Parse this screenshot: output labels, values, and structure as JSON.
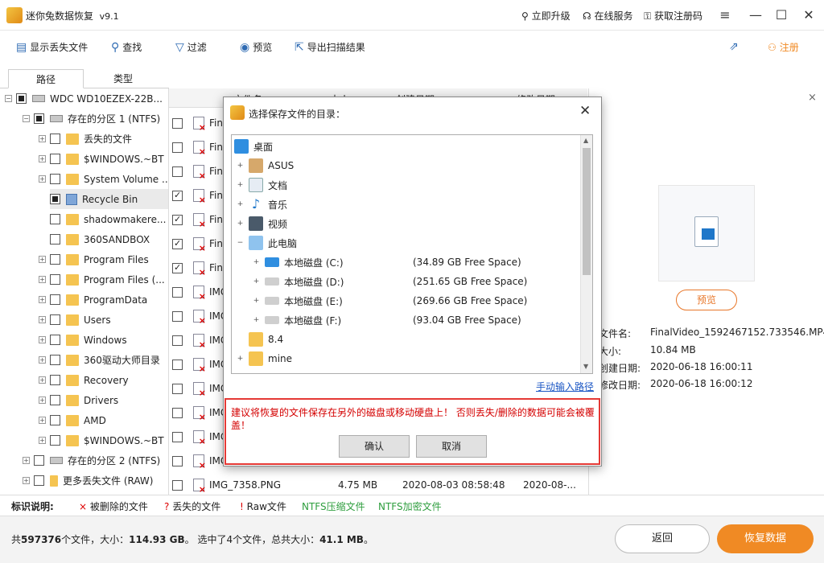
{
  "app": {
    "title": "迷你兔数据恢复",
    "version": "v9.1"
  },
  "titlebar": {
    "upgrade": "立即升级",
    "service": "在线服务",
    "register_code": "获取注册码"
  },
  "toolbar": {
    "show_lost": "显示丢失文件",
    "find": "查找",
    "filter": "过滤",
    "preview": "预览",
    "export": "导出扫描结果",
    "register": "注册"
  },
  "tabs": [
    "路径",
    "类型"
  ],
  "tree": [
    {
      "label": "WDC WD10EZEX-22B..."
    },
    {
      "label": "存在的分区 1 (NTFS)"
    },
    {
      "label": "丢失的文件"
    },
    {
      "label": "$WINDOWS.~BT"
    },
    {
      "label": "System Volume ..."
    },
    {
      "label": "Recycle Bin"
    },
    {
      "label": "shadowmakere..."
    },
    {
      "label": "360SANDBOX"
    },
    {
      "label": "Program Files"
    },
    {
      "label": "Program Files (..."
    },
    {
      "label": "ProgramData"
    },
    {
      "label": "Users"
    },
    {
      "label": "Windows"
    },
    {
      "label": "360驱动大师目录"
    },
    {
      "label": "Recovery"
    },
    {
      "label": "Drivers"
    },
    {
      "label": "AMD"
    },
    {
      "label": "$WINDOWS.~BT"
    },
    {
      "label": "存在的分区 2 (NTFS)"
    },
    {
      "label": "更多丢失文件 (RAW)"
    }
  ],
  "filelist": {
    "headers": [
      "文件名",
      "大小",
      "创建日期",
      "修改日期"
    ],
    "rows": [
      "Fina",
      "Fina",
      "Fina",
      "Fina",
      "Fina",
      "Fina",
      "Fina",
      "IMG_",
      "IMG_",
      "IMG_",
      "IMG_",
      "IMG_",
      "IMG_",
      "IMG_",
      "IMG_"
    ],
    "last": {
      "name": "IMG_7358.PNG",
      "size": "4.75 MB",
      "created": "2020-08-03 08:58:48",
      "modified": "2020-08-..."
    }
  },
  "preview": {
    "button": "预览",
    "labels": [
      "文件名:",
      "大小:",
      "创建日期:",
      "修改日期:"
    ],
    "values": [
      "FinalVideo_1592467152.733546.MP4",
      "10.84 MB",
      "2020-06-18 16:00:11",
      "2020-06-18 16:00:12"
    ]
  },
  "legend": {
    "title": "标识说明:",
    "deleted": "被删除的文件",
    "lost": "丢失的文件",
    "raw": "Raw文件",
    "ntfs_compressed": "NTFS压缩文件",
    "ntfs_encrypted": "NTFS加密文件"
  },
  "status": {
    "summary_prefix": "共",
    "total_files": "597376",
    "summary_mid": "个文件，大小：",
    "total_size": "114.93 GB",
    "summary_sel": "。 选中了4个文件，总共大小：",
    "sel_size": "41.1 MB",
    "summary_end": "。",
    "back": "返回",
    "recover": "恢复数据"
  },
  "dialog": {
    "title": "选择保存文件的目录：",
    "nodes": [
      {
        "label": "桌面",
        "space": ""
      },
      {
        "label": "ASUS",
        "space": ""
      },
      {
        "label": "文档",
        "space": ""
      },
      {
        "label": "音乐",
        "space": ""
      },
      {
        "label": "视频",
        "space": ""
      },
      {
        "label": "此电脑",
        "space": ""
      },
      {
        "label": "本地磁盘 (C:)",
        "space": "(34.89 GB Free Space)"
      },
      {
        "label": "本地磁盘 (D:)",
        "space": "(251.65 GB Free Space)"
      },
      {
        "label": "本地磁盘 (E:)",
        "space": "(269.66 GB Free Space)"
      },
      {
        "label": "本地磁盘 (F:)",
        "space": "(93.04 GB Free Space)"
      },
      {
        "label": "8.4",
        "space": ""
      },
      {
        "label": "mine",
        "space": ""
      }
    ],
    "manual_path": "手动输入路径",
    "warning": "建议将恢复的文件保存在另外的磁盘或移动硬盘上！ 否则丢失/删除的数据可能会被覆盖！",
    "ok": "确认",
    "cancel": "取消"
  },
  "colors": {
    "accent": "#f08a24",
    "warn": "#e53935",
    "link": "#1a56c4",
    "green": "#2e9e3e"
  }
}
